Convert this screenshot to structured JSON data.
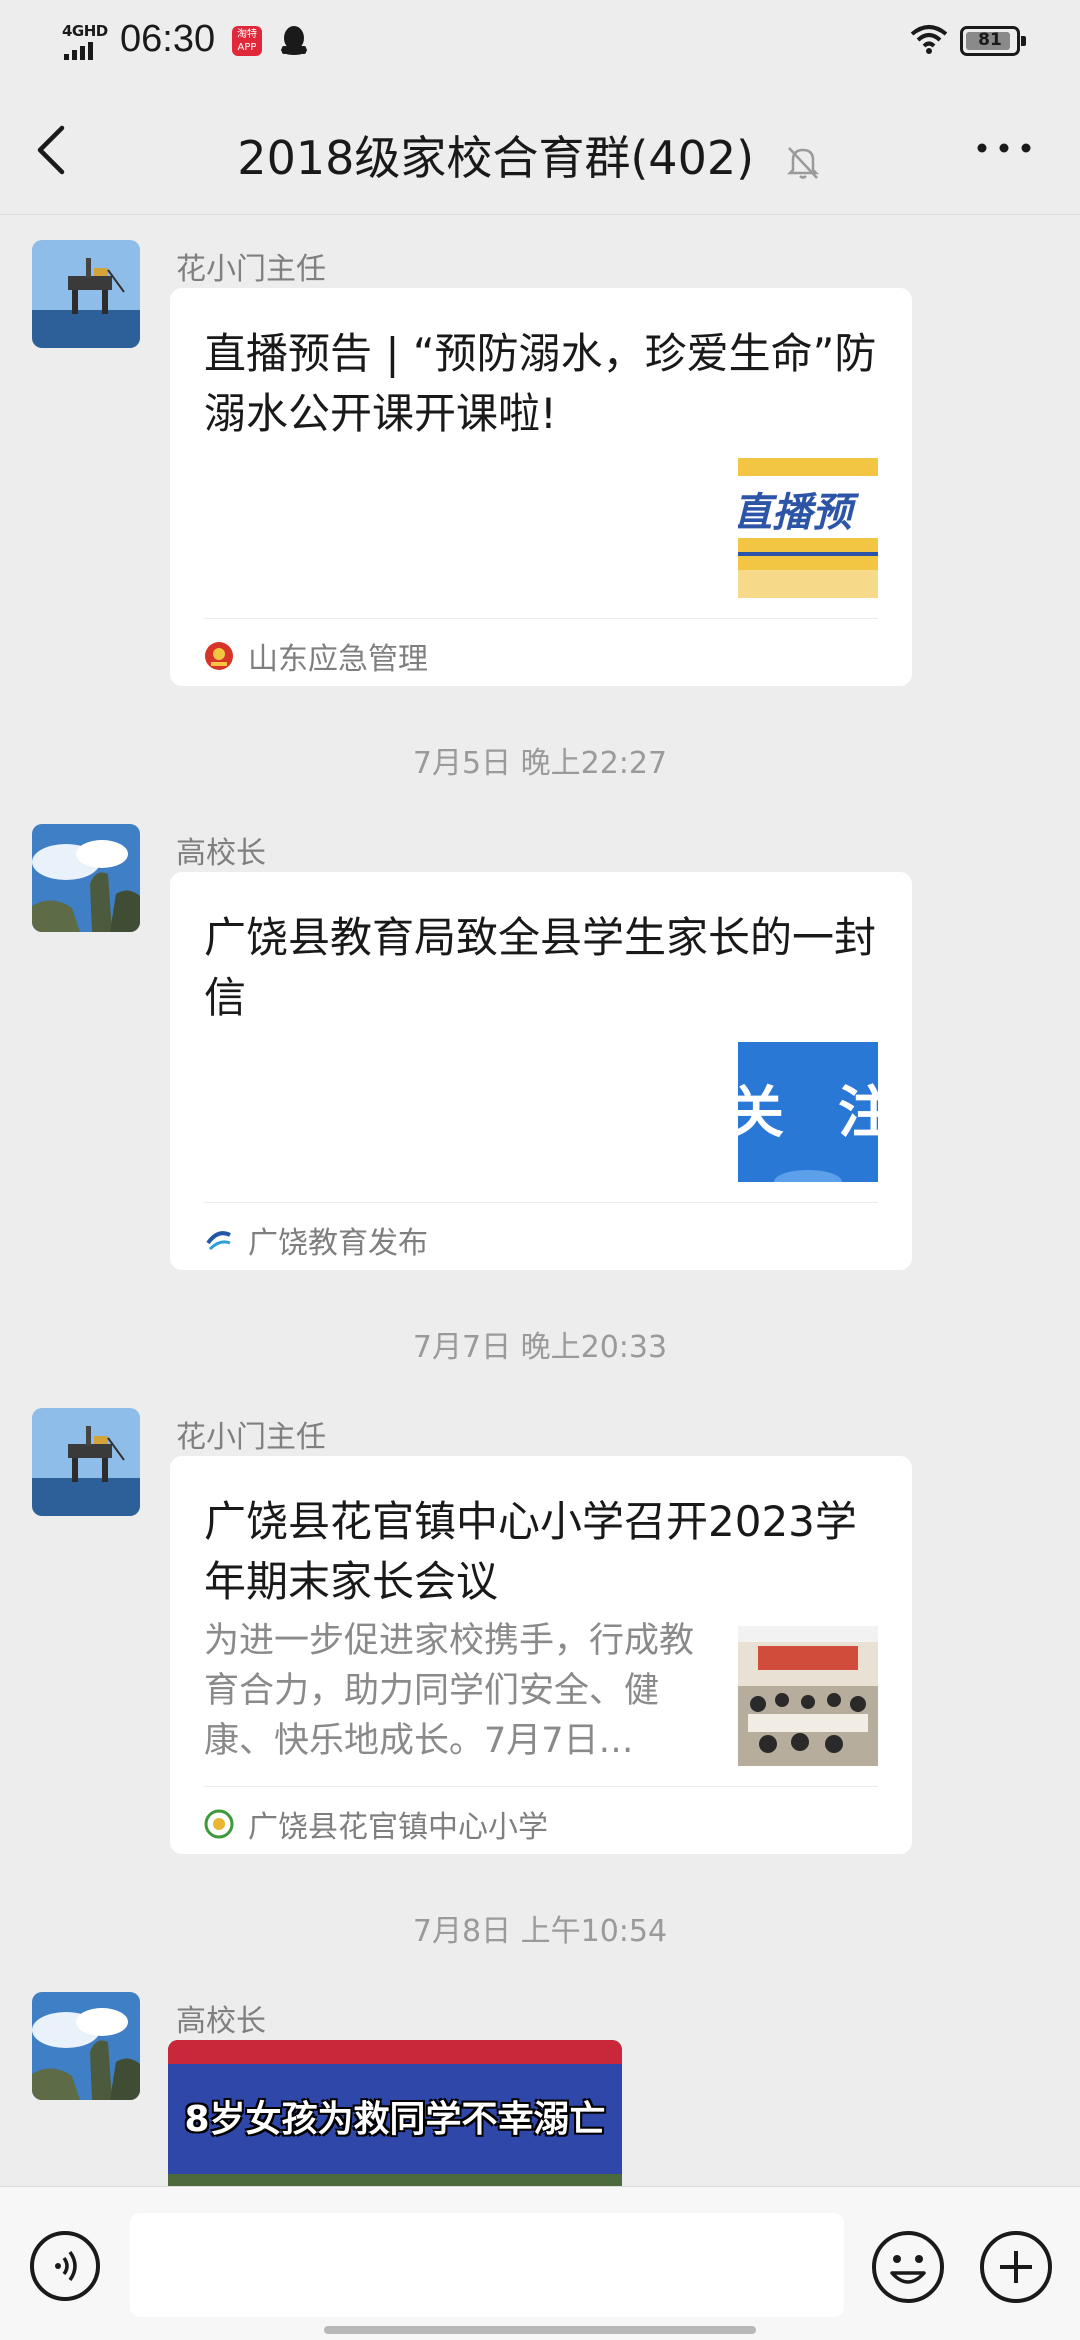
{
  "status_bar": {
    "network": "4GHD",
    "time": "06:30",
    "app_badge": "淘特APP",
    "battery": "81"
  },
  "header": {
    "title": "2018级家校合育群(402)"
  },
  "messages": [
    {
      "sender": "花小门主任",
      "title": "直播预告 | “预防溺水，珍爱生命”防溺水公开课开课啦!",
      "thumb_text": "直播预告",
      "source": "山东应急管理"
    },
    {
      "sender": "高校长",
      "title": "广饶县教育局致全县学生家长的一封信",
      "source": "广饶教育发布"
    },
    {
      "sender": "花小门主任",
      "title": "广饶县花官镇中心小学召开2023学年期末家长会议",
      "desc": "为进一步促进家校携手，行成教育合力，助力同学们安全、健康、快乐地成长。7月7日…",
      "source": "广饶县花官镇中心小学"
    },
    {
      "sender": "高校长",
      "video_title": "8岁女孩为救同学不幸溺亡"
    }
  ],
  "timestamps": [
    "7月5日 晚上22:27",
    "7月7日 晚上20:33",
    "7月8日 上午10:54"
  ],
  "input": {
    "value": ""
  }
}
